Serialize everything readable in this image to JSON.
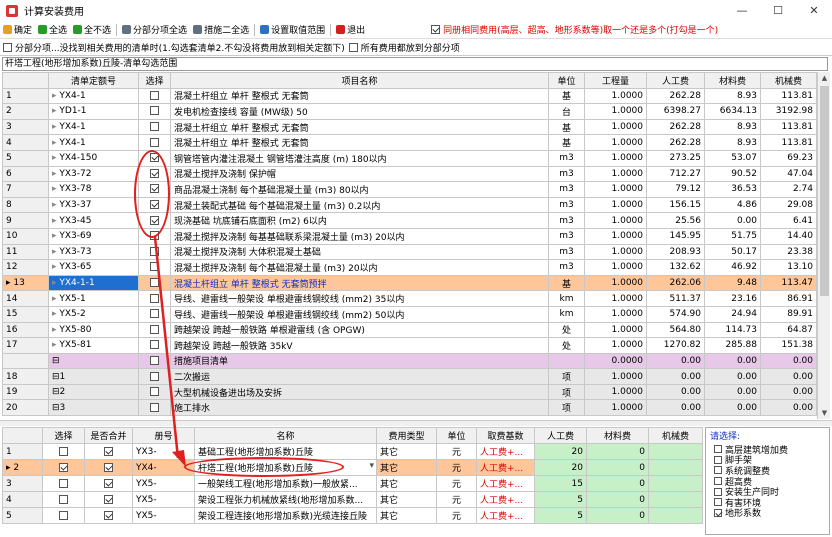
{
  "window": {
    "title": "计算安装费用",
    "min": "—",
    "max": "☐",
    "close": "✕"
  },
  "toolbar": [
    {
      "label": "确定",
      "icon": "confirm-icon",
      "color": "#e6a020"
    },
    {
      "label": "全选",
      "icon": "select-all-icon",
      "color": "#2a9a2a"
    },
    {
      "label": "全不选",
      "icon": "select-none-icon",
      "color": "#2a9a2a"
    },
    {
      "label": "分部分项全选",
      "icon": "grid-icon",
      "color": "#607080"
    },
    {
      "label": "措施二全选",
      "icon": "grid-icon",
      "color": "#607080"
    },
    {
      "label": "设置取值范围",
      "icon": "range-icon",
      "color": "#3070c0"
    },
    {
      "label": "退出",
      "icon": "exit-icon",
      "color": "#d02020"
    }
  ],
  "same_fee_option": {
    "label": "同册相同费用(高层、超高、地形系数等)取一个还是多个(打勾是一个)",
    "checked": true
  },
  "options": [
    {
      "label": "分部分项...没找到相关费用的清单时(1.勾选套清单2.不勾没将费用放到相关定额下)",
      "checked": false
    },
    {
      "label": "所有费用都放到分部分项",
      "checked": false
    }
  ],
  "filter_text": "杆塔工程(地形增加系数)丘陵-清单勾选范围",
  "grid": {
    "headers": [
      "",
      "清单定额号",
      "选择",
      "项目名称",
      "单位",
      "工程量",
      "人工费",
      "材料费",
      "机械费"
    ],
    "rows": [
      {
        "no": "1",
        "code": "YX4-1",
        "sel": false,
        "name": "混凝土杆组立 单杆 整根式 无套筒",
        "unit": "基",
        "qty": "1.0000",
        "labor": "262.28",
        "mat": "8.93",
        "mach": "113.81"
      },
      {
        "no": "2",
        "code": "YD1-1",
        "sel": false,
        "name": "发电机检查接线 容量 (MW级) 50",
        "unit": "台",
        "qty": "1.0000",
        "labor": "6398.27",
        "mat": "6634.13",
        "mach": "3192.98"
      },
      {
        "no": "3",
        "code": "YX4-1",
        "sel": false,
        "name": "混凝土杆组立 单杆 整根式 无套筒",
        "unit": "基",
        "qty": "1.0000",
        "labor": "262.28",
        "mat": "8.93",
        "mach": "113.81"
      },
      {
        "no": "4",
        "code": "YX4-1",
        "sel": false,
        "name": "混凝土杆组立 单杆 整根式 无套筒",
        "unit": "基",
        "qty": "1.0000",
        "labor": "262.28",
        "mat": "8.93",
        "mach": "113.81"
      },
      {
        "no": "5",
        "code": "YX4-150",
        "sel": true,
        "name": "钢管塔管内灌注混凝土 钢管塔灌注高度 (m) 180以内",
        "unit": "m3",
        "qty": "1.0000",
        "labor": "273.25",
        "mat": "53.07",
        "mach": "69.23"
      },
      {
        "no": "6",
        "code": "YX3-72",
        "sel": true,
        "name": "混凝土搅拌及浇制 保护帽",
        "unit": "m3",
        "qty": "1.0000",
        "labor": "712.27",
        "mat": "90.52",
        "mach": "47.04"
      },
      {
        "no": "7",
        "code": "YX3-78",
        "sel": true,
        "name": "商品混凝土浇制 每个基础混凝土量 (m3) 80以内",
        "unit": "m3",
        "qty": "1.0000",
        "labor": "79.12",
        "mat": "36.53",
        "mach": "2.74"
      },
      {
        "no": "8",
        "code": "YX3-37",
        "sel": true,
        "name": "混凝土装配式基础 每个基础混凝土量 (m3) 0.2以内",
        "unit": "m3",
        "qty": "1.0000",
        "labor": "156.15",
        "mat": "4.86",
        "mach": "29.08"
      },
      {
        "no": "9",
        "code": "YX3-45",
        "sel": true,
        "name": "现浇基础 坑底铺石底面积 (m2) 6以内",
        "unit": "m3",
        "qty": "1.0000",
        "labor": "25.56",
        "mat": "0.00",
        "mach": "6.41"
      },
      {
        "no": "10",
        "code": "YX3-69",
        "sel": false,
        "name": "混凝土搅拌及浇制 每基基础联系梁混凝土量 (m3) 20以内",
        "unit": "m3",
        "qty": "1.0000",
        "labor": "145.95",
        "mat": "51.75",
        "mach": "14.40"
      },
      {
        "no": "11",
        "code": "YX3-73",
        "sel": false,
        "name": "混凝土搅拌及浇制 大体积混凝土基础",
        "unit": "m3",
        "qty": "1.0000",
        "labor": "208.93",
        "mat": "50.17",
        "mach": "23.38"
      },
      {
        "no": "12",
        "code": "YX3-65",
        "sel": false,
        "name": "混凝土搅拌及浇制 每个基础混凝土量 (m3) 20以内",
        "unit": "m3",
        "qty": "1.0000",
        "labor": "132.62",
        "mat": "46.92",
        "mach": "13.10"
      },
      {
        "no": "13",
        "code": "YX4-1-1",
        "sel": false,
        "name": "混凝土杆组立 单杆 整根式 无套筒预拌",
        "unit": "基",
        "qty": "1.0000",
        "labor": "262.06",
        "mat": "9.48",
        "mach": "113.47",
        "style": "selected"
      },
      {
        "no": "14",
        "code": "YX5-1",
        "sel": false,
        "name": "导线、避雷线一般架设 单根避雷线钢绞线 (mm2) 35以内",
        "unit": "km",
        "qty": "1.0000",
        "labor": "511.37",
        "mat": "23.16",
        "mach": "86.91"
      },
      {
        "no": "15",
        "code": "YX5-2",
        "sel": false,
        "name": "导线、避雷线一般架设 单根避雷线钢绞线 (mm2) 50以内",
        "unit": "km",
        "qty": "1.0000",
        "labor": "574.90",
        "mat": "24.94",
        "mach": "89.91"
      },
      {
        "no": "16",
        "code": "YX5-80",
        "sel": false,
        "name": "跨越架设 跨越一般铁路 单根避雷线 (含 OPGW)",
        "unit": "处",
        "qty": "1.0000",
        "labor": "564.80",
        "mat": "114.73",
        "mach": "64.87"
      },
      {
        "no": "17",
        "code": "YX5-81",
        "sel": false,
        "name": "跨越架设 跨越一般铁路 35kV",
        "unit": "处",
        "qty": "1.0000",
        "labor": "1270.82",
        "mat": "285.88",
        "mach": "151.38"
      },
      {
        "no": "",
        "code": "⊟",
        "sel": false,
        "name": "措施项目清单",
        "unit": "",
        "qty": "0.0000",
        "labor": "0.00",
        "mat": "0.00",
        "mach": "0.00",
        "style": "purple"
      },
      {
        "no": "18",
        "code": "⊟1",
        "sel": false,
        "name": "二次搬运",
        "unit": "项",
        "qty": "1.0000",
        "labor": "0.00",
        "mat": "0.00",
        "mach": "0.00",
        "style": "gray"
      },
      {
        "no": "19",
        "code": "⊟2",
        "sel": false,
        "name": "大型机械设备进出场及安拆",
        "unit": "项",
        "qty": "1.0000",
        "labor": "0.00",
        "mat": "0.00",
        "mach": "0.00",
        "style": "gray"
      },
      {
        "no": "20",
        "code": "⊟3",
        "sel": false,
        "name": "施工排水",
        "unit": "项",
        "qty": "1.0000",
        "labor": "0.00",
        "mat": "0.00",
        "mach": "0.00",
        "style": "gray"
      }
    ]
  },
  "grid2": {
    "headers": [
      "",
      "选择",
      "是否合并",
      "册号",
      "名称",
      "费用类型",
      "单位",
      "取费基数",
      "人工费",
      "材料费",
      "机械费"
    ],
    "rows": [
      {
        "no": "1",
        "sel": false,
        "merge": true,
        "book": "YX3-",
        "name": "基础工程(地形增加系数)丘陵",
        "type": "其它",
        "unit": "元",
        "base": "人工费+...",
        "labor": "20",
        "mat": "0",
        "mach": ""
      },
      {
        "no": "2",
        "sel": true,
        "merge": true,
        "book": "YX4-",
        "name": "杆塔工程(地形增加系数)丘陵",
        "type": "其它",
        "unit": "元",
        "base": "人工费+...",
        "labor": "20",
        "mat": "0",
        "mach": "",
        "active": true
      },
      {
        "no": "3",
        "sel": false,
        "merge": true,
        "book": "YX5-",
        "name": "一般架线工程(地形增加系数)一般放紧...",
        "type": "其它",
        "unit": "元",
        "base": "人工费+...",
        "labor": "15",
        "mat": "0",
        "mach": ""
      },
      {
        "no": "4",
        "sel": false,
        "merge": true,
        "book": "YX5-",
        "name": "架设工程张力机械放紧线(地形增加系数...",
        "type": "其它",
        "unit": "元",
        "base": "人工费+...",
        "labor": "5",
        "mat": "0",
        "mach": ""
      },
      {
        "no": "5",
        "sel": false,
        "merge": true,
        "book": "YX5-",
        "name": "架设工程连接(地形增加系数)光缆连接丘陵",
        "type": "其它",
        "unit": "元",
        "base": "人工费+...",
        "labor": "5",
        "mat": "0",
        "mach": ""
      }
    ]
  },
  "panel": {
    "title": "请选择:",
    "items": [
      {
        "label": "高层建筑增加费",
        "checked": false
      },
      {
        "label": "脚手架",
        "checked": false
      },
      {
        "label": "系统调整费",
        "checked": false
      },
      {
        "label": "超高费",
        "checked": false
      },
      {
        "label": "安装生产同时",
        "checked": false
      },
      {
        "label": "有害环境",
        "checked": false
      },
      {
        "label": "地形系数",
        "checked": true
      }
    ]
  }
}
